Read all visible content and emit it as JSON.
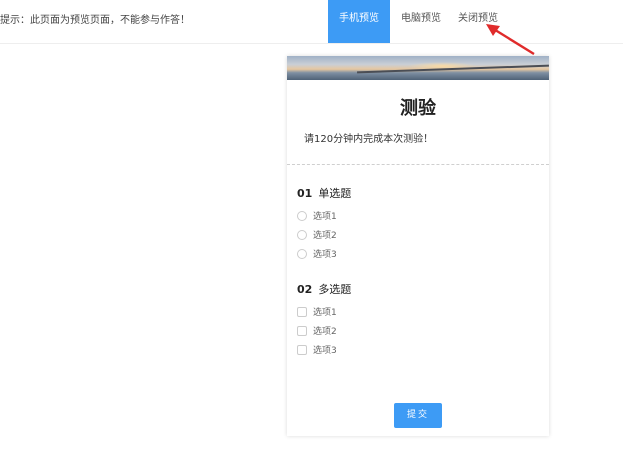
{
  "topbar": {
    "hint": "提示：此页面为预览页面，不能参与作答！",
    "tabs": [
      {
        "label": "手机预览",
        "active": true
      },
      {
        "label": "电脑预览",
        "active": false
      },
      {
        "label": "关闭预览",
        "active": false
      }
    ]
  },
  "quiz": {
    "title": "测验",
    "description": "请120分钟内完成本次测验！",
    "questions": [
      {
        "number": "01",
        "type_label": "单选题",
        "input": "radio",
        "options": [
          "选项1",
          "选项2",
          "选项3"
        ]
      },
      {
        "number": "02",
        "type_label": "多选题",
        "input": "checkbox",
        "options": [
          "选项1",
          "选项2",
          "选项3"
        ]
      }
    ],
    "submit_label": "提交"
  },
  "colors": {
    "accent": "#3d9bf5",
    "annotation_arrow": "#e02b2b"
  }
}
